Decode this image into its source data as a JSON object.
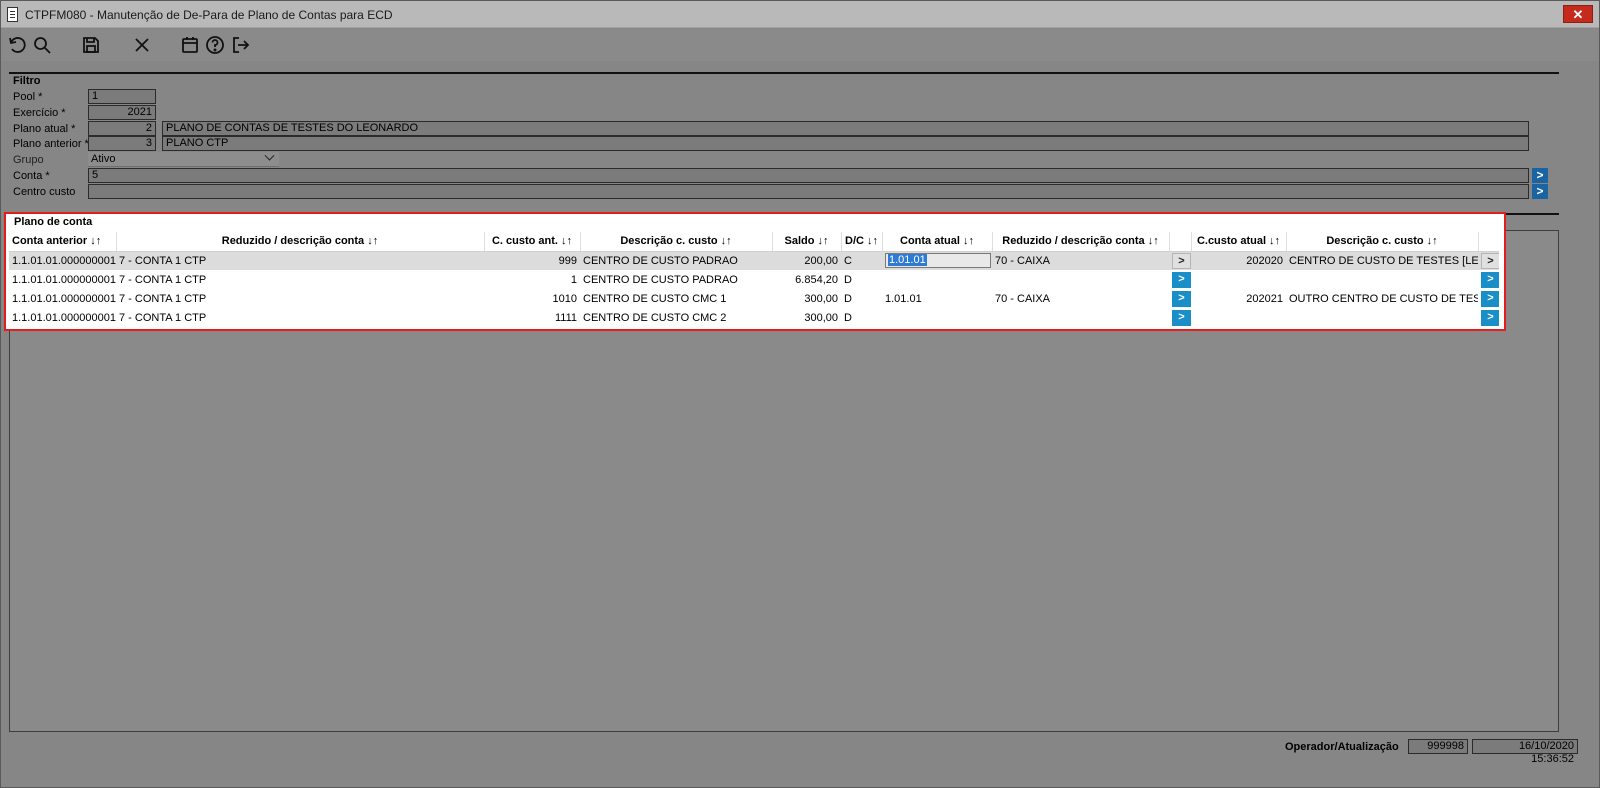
{
  "window": {
    "title": "CTPFM080 - Manutenção de De-Para de Plano de Contas para ECD",
    "close_label": "✕"
  },
  "toolbar": {
    "icons": [
      "refresh-icon",
      "search-icon",
      "save-icon",
      "cancel-icon",
      "calendar-icon",
      "help-icon",
      "exit-icon"
    ]
  },
  "filtro": {
    "title": "Filtro",
    "pool": {
      "label": "Pool *",
      "value": "1"
    },
    "exercicio": {
      "label": "Exercício *",
      "value": "2021"
    },
    "plano_atual": {
      "label": "Plano atual *",
      "code": "2",
      "desc": "PLANO DE CONTAS DE TESTES DO LEONARDO"
    },
    "plano_anterior": {
      "label": "Plano anterior *",
      "code": "3",
      "desc": "PLANO CTP"
    },
    "grupo": {
      "label": "Grupo",
      "value": "Ativo"
    },
    "conta": {
      "label": "Conta *",
      "value": "5"
    },
    "centro_custo": {
      "label": "Centro custo",
      "value": ""
    },
    "lookup_label": ">"
  },
  "plano": {
    "title": "Plano de conta",
    "columns": [
      "Conta anterior  ↓↑",
      "Reduzido / descrição conta ↓↑",
      "C. custo ant. ↓↑",
      "Descrição c. custo ↓↑",
      "Saldo ↓↑",
      "D/C ↓↑",
      "Conta atual ↓↑",
      "Reduzido / descrição conta ↓↑",
      "",
      "C.custo atual ↓↑",
      "Descrição c. custo ↓↑",
      ""
    ],
    "rows": [
      {
        "conta_anterior": "1.1.01.01.000000001",
        "reduzido": "7 - CONTA 1 CTP",
        "ccusto_ant": "999",
        "desc_ccusto": "CENTRO DE CUSTO PADRAO",
        "saldo": "200,00",
        "dc": "C",
        "conta_atual": "1.01.01",
        "reduzido_atual": "70 - CAIXA",
        "btn1": ">",
        "ccusto_atual": "202020",
        "desc_ccusto_atual": "CENTRO DE CUSTO DE TESTES [LEONA",
        "btn2": ">"
      },
      {
        "conta_anterior": "1.1.01.01.000000001",
        "reduzido": "7 - CONTA 1 CTP",
        "ccusto_ant": "1",
        "desc_ccusto": "CENTRO DE CUSTO PADRAO",
        "saldo": "6.854,20",
        "dc": "D",
        "conta_atual": "",
        "reduzido_atual": "",
        "btn1": ">",
        "ccusto_atual": "",
        "desc_ccusto_atual": "",
        "btn2": ">"
      },
      {
        "conta_anterior": "1.1.01.01.000000001",
        "reduzido": "7 - CONTA 1 CTP",
        "ccusto_ant": "1010",
        "desc_ccusto": "CENTRO DE CUSTO CMC 1",
        "saldo": "300,00",
        "dc": "D",
        "conta_atual": "1.01.01",
        "reduzido_atual": "70 - CAIXA",
        "btn1": ">",
        "ccusto_atual": "202021",
        "desc_ccusto_atual": "OUTRO CENTRO DE CUSTO DE TESTES",
        "btn2": ">"
      },
      {
        "conta_anterior": "1.1.01.01.000000001",
        "reduzido": "7 - CONTA 1 CTP",
        "ccusto_ant": "1111",
        "desc_ccusto": "CENTRO DE CUSTO CMC 2",
        "saldo": "300,00",
        "dc": "D",
        "conta_atual": "",
        "reduzido_atual": "",
        "btn1": ">",
        "ccusto_atual": "",
        "desc_ccusto_atual": "",
        "btn2": ">"
      }
    ]
  },
  "status": {
    "label": "Operador/Atualização",
    "operador": "999998",
    "atualizacao": "16/10/2020 15:36:52"
  }
}
